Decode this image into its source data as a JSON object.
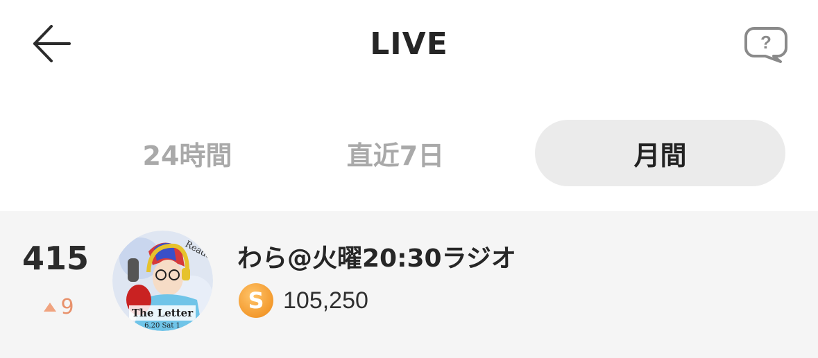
{
  "header": {
    "back_icon": "arrow-left-icon",
    "title": "LIVE",
    "help_icon": "question-bubble-icon"
  },
  "tabs": [
    {
      "label": "24時間",
      "active": false
    },
    {
      "label": "直近7日",
      "active": false
    },
    {
      "label": "月間",
      "active": true
    }
  ],
  "ranking": [
    {
      "rank": "415",
      "change": "9",
      "change_direction": "up",
      "avatar_text_top": "Reader",
      "avatar_text_bottom": "The Letter",
      "avatar_text_date": "6.20 Sat 1",
      "name": "わら@火曜20:30ラジオ",
      "coin_label": "S",
      "points": "105,250"
    }
  ],
  "colors": {
    "row_background": "#f5f5f5",
    "active_tab_background": "#ebebeb",
    "inactive_tab_text": "#a9a9a9",
    "rank_up": "#e8916b",
    "coin": "#f39a2e"
  }
}
